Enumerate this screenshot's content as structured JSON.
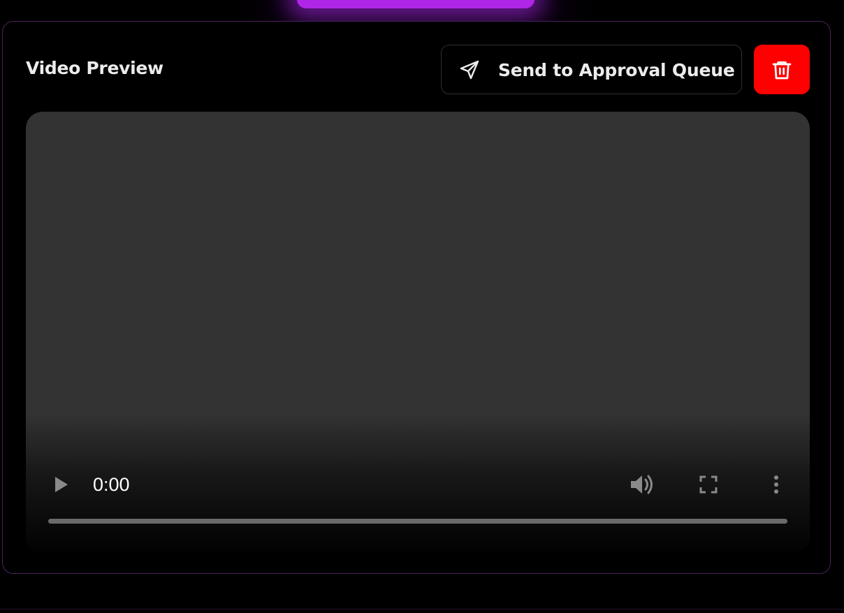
{
  "panel": {
    "title": "Video Preview",
    "send_button_label": "Send to Approval Queue",
    "send_icon": "send-icon",
    "delete_icon": "trash-icon"
  },
  "video_player": {
    "current_time": "0:00",
    "progress": 0,
    "icons": [
      "play-icon",
      "volume-icon",
      "fullscreen-icon",
      "more-options-icon"
    ]
  },
  "colors": {
    "background": "#000000",
    "card_border": "#4a2260",
    "accent_glow": "#b026e8",
    "delete_button": "#ff0000",
    "video_surface": "#333333",
    "text": "#ececec"
  }
}
